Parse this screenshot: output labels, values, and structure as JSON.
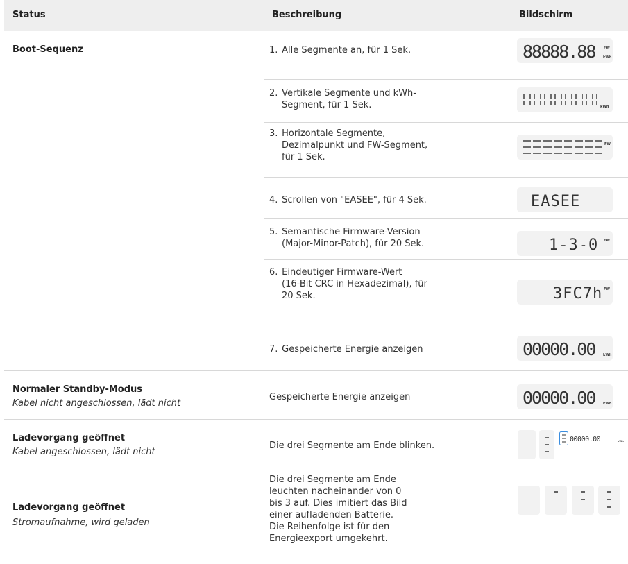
{
  "header": {
    "status": "Status",
    "description": "Beschreibung",
    "display": "Bildschirm"
  },
  "boot": {
    "title": "Boot-Sequenz",
    "steps": [
      {
        "num": "1.",
        "lines": [
          "Alle Segmente an, für 1 Sek."
        ]
      },
      {
        "num": "2.",
        "lines": [
          "Vertikale Segmente und kWh-",
          "Segment, für 1 Sek."
        ]
      },
      {
        "num": "3.",
        "lines": [
          "Horizontale Segmente,",
          "Dezimalpunkt und FW-Segment,",
          "für 1 Sek."
        ]
      },
      {
        "num": "4.",
        "lines": [
          "Scrollen von \"EASEE\", für 4 Sek."
        ]
      },
      {
        "num": "5.",
        "lines": [
          "Semantische Firmware-Version",
          "(Major-Minor-Patch), für 20 Sek."
        ]
      },
      {
        "num": "6.",
        "lines": [
          "Eindeutiger Firmware-Wert",
          "(16-Bit CRC in Hexadezimal), für",
          "20 Sek."
        ]
      },
      {
        "num": "7.",
        "lines": [
          "Gespeicherte Energie anzeigen"
        ]
      }
    ]
  },
  "standby": {
    "title": "Normaler Standby-Modus",
    "subtitle": "Kabel nicht angeschlossen, lädt nicht",
    "description": "Gespeicherte Energie anzeigen"
  },
  "open": {
    "title": "Ladevorgang geöffnet",
    "subtitle": "Kabel angeschlossen, lädt nicht",
    "description": "Die drei Segmente am Ende blinken."
  },
  "charging": {
    "title": "Ladevorgang geöffnet",
    "subtitle": "Stromaufnahme, wird geladen",
    "lines": [
      "Die drei Segmente am Ende",
      "leuchten nacheinander von 0",
      "bis 3 auf. Dies imitiert das Bild",
      "einer aufladenden Batterie.",
      "Die Reihenfolge ist für den",
      "Energieexport umgekehrt."
    ]
  },
  "lcd": {
    "all_on": "88888.88",
    "vertical": "||||||||",
    "horizontal": "--------",
    "easee": "EASEE",
    "version": "1-3-0",
    "crc": "3FC7h",
    "energy": "00000.00",
    "small_energy": "00000.00",
    "unit_fw": "FW",
    "unit_kwh": "kWh"
  }
}
